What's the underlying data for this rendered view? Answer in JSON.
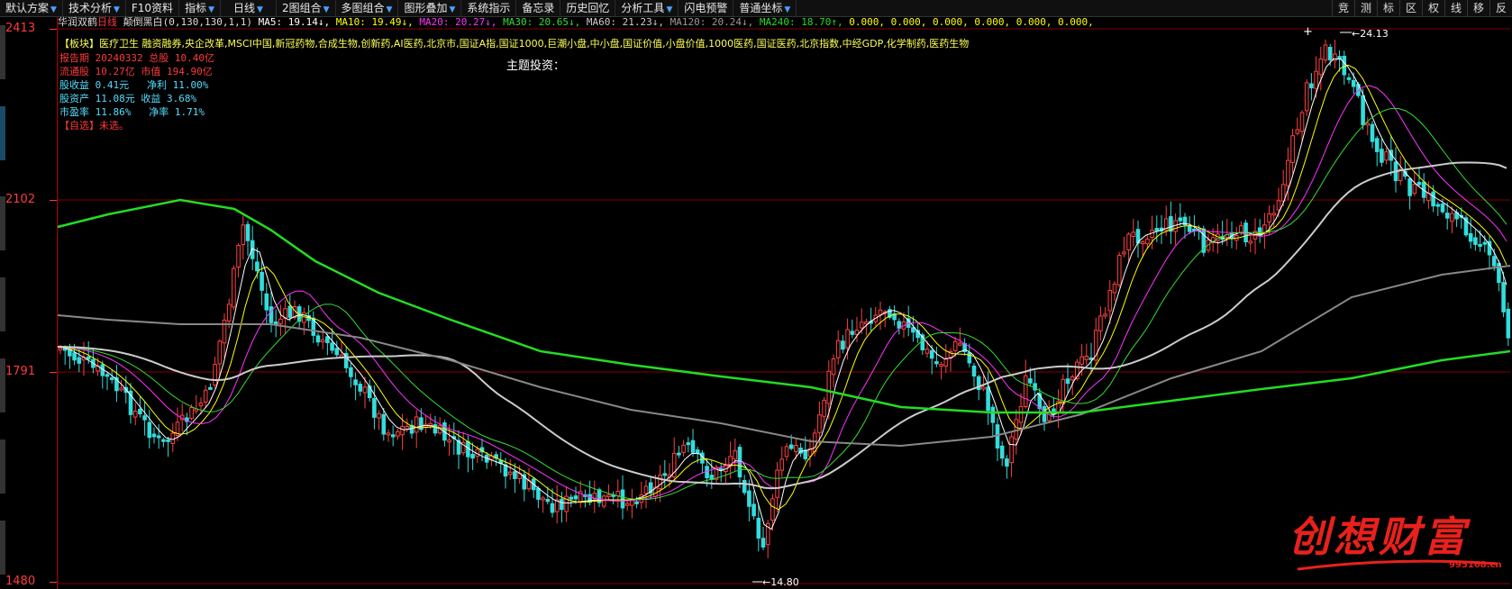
{
  "toolbar": {
    "items": [
      "默认方案",
      "技术分析",
      "F10资料",
      "指标",
      "日线",
      "2图组合",
      "多图组合",
      "图形叠加",
      "系统指示",
      "备忘录",
      "历史回忆",
      "分析工具",
      "闪电预警",
      "普通坐标"
    ],
    "right_items": [
      "竞",
      "测",
      "标",
      "区",
      "权",
      "线",
      "移",
      "反"
    ]
  },
  "info": {
    "stock_name": "华润双鹤",
    "period": "日线",
    "mode": "颠倒黑白(0,130,130,1,1)",
    "ma5": "MA5: 19.14↓,",
    "ma10": "MA10: 19.49↓,",
    "ma20": "MA20: 20.27↓,",
    "ma30": "MA30: 20.65↓,",
    "ma60": "MA60: 21.23↓,",
    "ma120": "MA120: 20.24↓,",
    "ma240": "MA240: 18.70↑,",
    "zeros": "0.000, 0.000, 0.000, 0.000, 0.000, 0.000,"
  },
  "colors": {
    "ma5": "#ffffff",
    "ma10": "#ffff00",
    "ma20": "#ff33ff",
    "ma30": "#33dd33",
    "ma60": "#cccccc",
    "ma120": "#888888",
    "ma240": "#22dd22",
    "up": "#ff4040",
    "down": "#33dddd",
    "grid": "#800000"
  },
  "concepts": {
    "tag": "【板块】",
    "text": "医疗卫生 融资融券,央企改革,MSCI中国,新冠药物,合成生物,创新药,AI医药,北京市,国证A指,国证1000,巨潮小盘,中小盘,国证价值,小盘价值,1000医药,国证医药,北京指数,中经GDP,化学制药,医药生物"
  },
  "theme_label": "主题投资：",
  "fundamentals": {
    "report_date_label": "报告期",
    "report_date": "20240332",
    "total_shares_label": "总股",
    "total_shares": "10.40亿",
    "float_label": "流通股",
    "float": "10.27亿",
    "mcap_label": "市值",
    "mcap": "194.90亿",
    "eps_label": "股收益",
    "eps": "0.41元",
    "net_label": "净利",
    "net": "11.00%",
    "bvps_label": "股资产",
    "bvps": "11.08元",
    "income_label": "收益",
    "income": "3.68%",
    "pe_label": "市盈率",
    "pe": "11.86%",
    "npm_label": "净率",
    "npm": "1.71%",
    "watchlist": "【自选】未选。"
  },
  "axis": {
    "labels": [
      "2413",
      "2102",
      "1791",
      "1480"
    ]
  },
  "extremes": {
    "high": "24.13",
    "low": "14.80"
  },
  "watermark": {
    "text": "创想财富",
    "url": "995168.cn"
  },
  "chart_data": {
    "type": "candlestick",
    "title": "华润双鹤 日线",
    "ylim": [
      14.8,
      24.13
    ],
    "high": 24.13,
    "low": 14.8,
    "moving_averages": {
      "MA5": 19.14,
      "MA10": 19.49,
      "MA20": 20.27,
      "MA30": 20.65,
      "MA60": 21.23,
      "MA120": 20.24,
      "MA240": 18.7
    },
    "y_tick_labels": [
      "2413",
      "2102",
      "1791",
      "1480"
    ]
  }
}
